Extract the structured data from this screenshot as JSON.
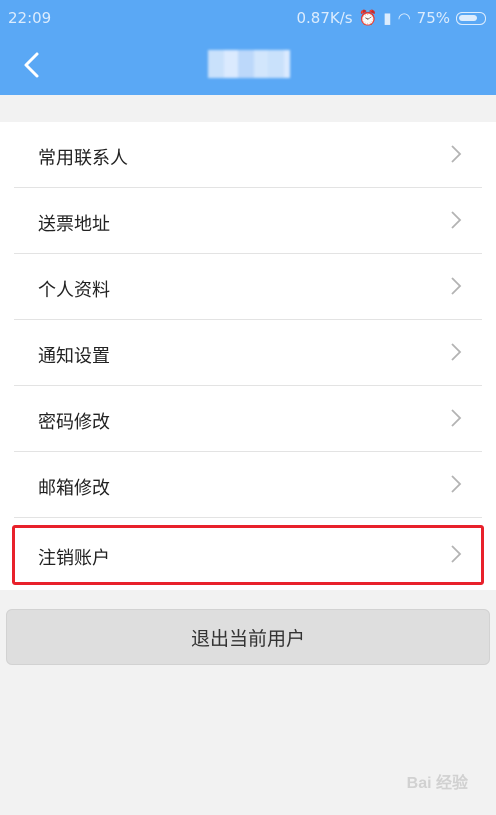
{
  "status_bar": {
    "time": "22:09",
    "network_speed": "0.87K/s",
    "battery": "75%"
  },
  "header": {
    "back_icon": "chevron-left-icon"
  },
  "menu": {
    "items": [
      {
        "label": "常用联系人"
      },
      {
        "label": "送票地址"
      },
      {
        "label": "个人资料"
      },
      {
        "label": "通知设置"
      },
      {
        "label": "密码修改"
      },
      {
        "label": "邮箱修改"
      },
      {
        "label": "注销账户"
      }
    ]
  },
  "logout": {
    "label": "退出当前用户"
  },
  "watermark": {
    "text": "Bai 经验"
  },
  "colors": {
    "header": "#5aa8f5",
    "highlight": "#e8212b"
  }
}
